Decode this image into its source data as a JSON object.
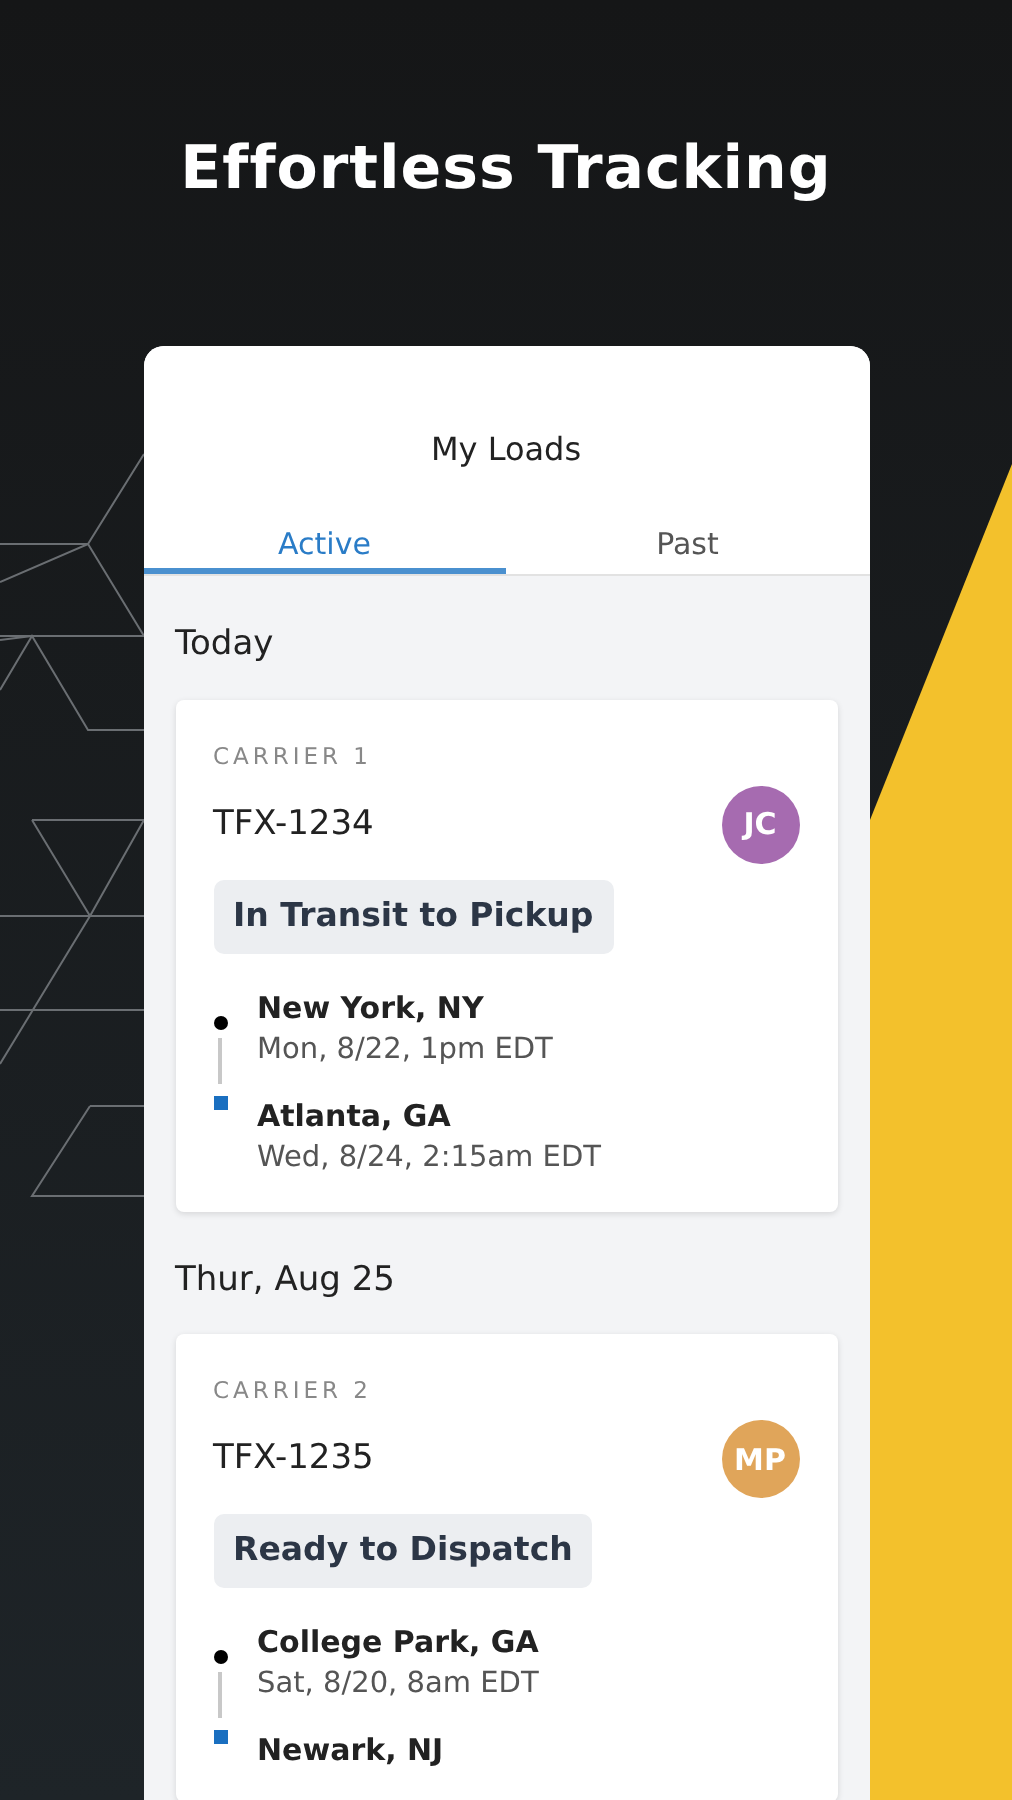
{
  "headline": "Effortless Tracking",
  "screen": {
    "title": "My Loads",
    "tabs": [
      {
        "label": "Active",
        "selected": true
      },
      {
        "label": "Past",
        "selected": false
      }
    ],
    "groups": [
      {
        "heading": "Today",
        "loads": [
          {
            "carrier": "CARRIER 1",
            "id": "TFX-1234",
            "initials": "JC",
            "color": "#a66bb0",
            "status": "In Transit to Pickup",
            "stops": [
              {
                "kind": "origin",
                "place": "New York, NY",
                "time": "Mon, 8/22, 1pm EDT"
              },
              {
                "kind": "destination",
                "place": "Atlanta, GA",
                "time": "Wed, 8/24, 2:15am EDT"
              }
            ]
          }
        ]
      },
      {
        "heading": "Thur, Aug 25",
        "loads": [
          {
            "carrier": "CARRIER 2",
            "id": "TFX-1235",
            "initials": "MP",
            "color": "#e0a55a",
            "status": "Ready to Dispatch",
            "stops": [
              {
                "kind": "origin",
                "place": "College Park, GA",
                "time": "Sat, 8/20, 8am EDT"
              },
              {
                "kind": "destination",
                "place": "Newark, NJ"
              }
            ]
          }
        ]
      }
    ]
  }
}
